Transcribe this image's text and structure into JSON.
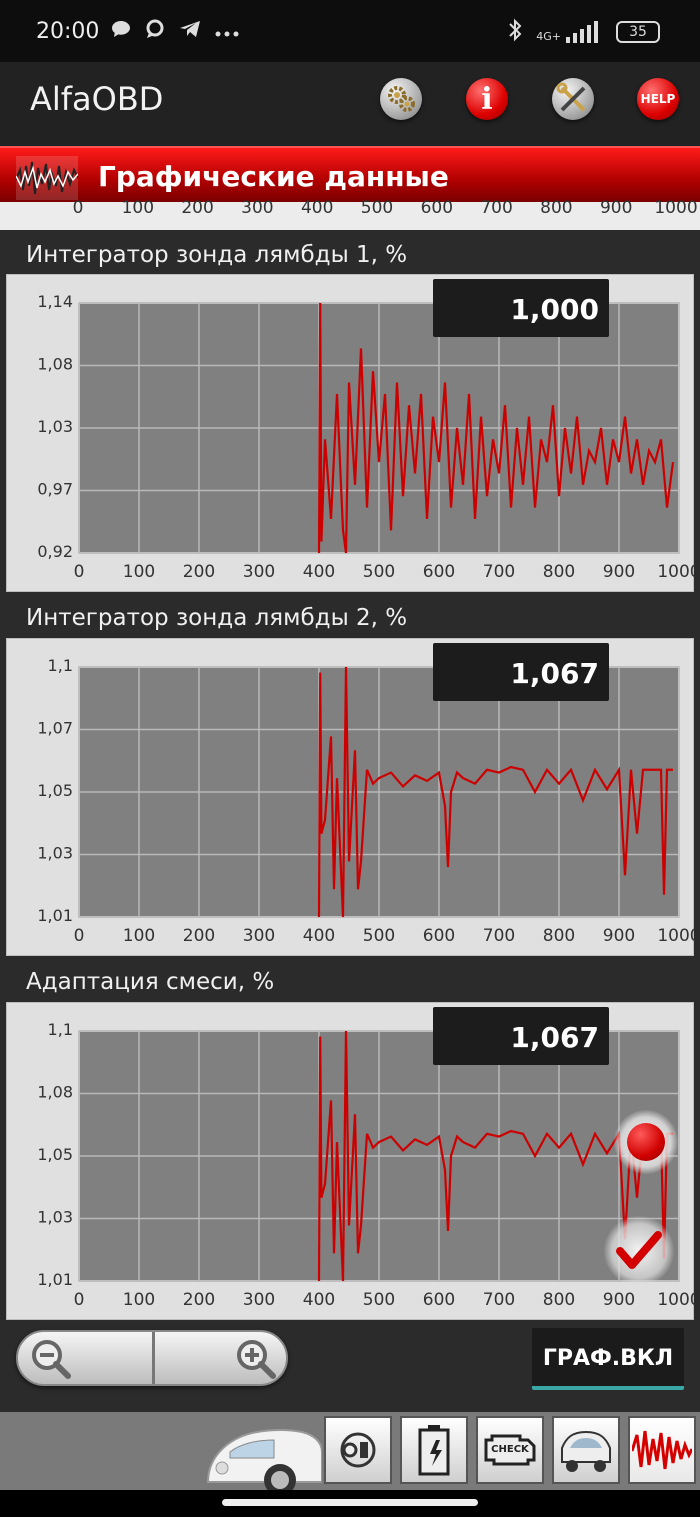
{
  "status_bar": {
    "time": "20:00",
    "network": "4G+",
    "battery": "35",
    "icons": [
      "chat-icon",
      "message-icon",
      "telegram-icon",
      "more-icon",
      "bluetooth-icon",
      "signal-icon",
      "battery-icon"
    ]
  },
  "app_bar": {
    "title": "AlfaOBD",
    "buttons": [
      {
        "name": "settings-gears-button",
        "icon": "gears-icon"
      },
      {
        "name": "info-button",
        "icon": "info-icon",
        "label": "i"
      },
      {
        "name": "tools-button",
        "icon": "tools-icon"
      },
      {
        "name": "help-button",
        "icon": "help-icon",
        "label": "HELP"
      }
    ]
  },
  "header": {
    "title": "Графические данные"
  },
  "shared_x_ticks": [
    "0",
    "100",
    "200",
    "300",
    "400",
    "500",
    "600",
    "700",
    "800",
    "900",
    "1000"
  ],
  "charts": [
    {
      "title": "Интегратор зонда лямбды 1, %",
      "current_value": "1,000",
      "y_ticks": [
        "1,14",
        "1,08",
        "1,03",
        "0,97",
        "0,92"
      ]
    },
    {
      "title": "Интегратор зонда лямбды 2, %",
      "current_value": "1,067",
      "y_ticks": [
        "1,1",
        "1,07",
        "1,05",
        "1,03",
        "1,01"
      ]
    },
    {
      "title": "Адаптация смеси, %",
      "current_value": "1,067",
      "y_ticks": [
        "1,1",
        "1,08",
        "1,05",
        "1,03",
        "1,01"
      ]
    }
  ],
  "chart_data": [
    {
      "type": "line",
      "title": "Интегратор зонда лямбды 1, %",
      "x_ticks": [
        0,
        100,
        200,
        300,
        400,
        500,
        600,
        700,
        800,
        900,
        1000
      ],
      "ylim": [
        0.92,
        1.14
      ],
      "y_ticks": [
        1.14,
        1.08,
        1.03,
        0.97,
        0.92
      ],
      "grid": true,
      "color": "#cc0000",
      "series": [
        {
          "x": [
            400,
            402,
            404,
            410,
            420,
            430,
            440,
            445,
            450,
            460,
            470,
            480,
            490,
            500,
            510,
            520,
            530,
            540,
            550,
            560,
            570,
            580,
            590,
            600,
            610,
            620,
            630,
            640,
            650,
            660,
            670,
            680,
            690,
            700,
            710,
            720,
            730,
            740,
            750,
            760,
            770,
            780,
            790,
            800,
            810,
            820,
            830,
            840,
            850,
            860,
            870,
            880,
            890,
            900,
            910,
            920,
            930,
            940,
            950,
            960,
            970,
            980,
            990
          ],
          "y": [
            0.92,
            1.14,
            0.93,
            1.02,
            0.95,
            1.06,
            0.94,
            0.92,
            1.07,
            0.98,
            1.1,
            0.96,
            1.08,
            1.0,
            1.06,
            0.94,
            1.07,
            0.97,
            1.05,
            0.99,
            1.06,
            0.95,
            1.04,
            1.0,
            1.07,
            0.96,
            1.03,
            0.98,
            1.06,
            0.95,
            1.04,
            0.97,
            1.02,
            0.99,
            1.05,
            0.96,
            1.03,
            0.98,
            1.04,
            0.96,
            1.02,
            1.0,
            1.05,
            0.97,
            1.03,
            0.99,
            1.04,
            0.98,
            1.01,
            1.0,
            1.03,
            0.98,
            1.02,
            1.0,
            1.04,
            0.99,
            1.02,
            0.98,
            1.01,
            1.0,
            1.02,
            0.96,
            1.0
          ]
        }
      ]
    },
    {
      "type": "line",
      "title": "Интегратор зонда лямбды 2, %",
      "x_ticks": [
        0,
        100,
        200,
        300,
        400,
        500,
        600,
        700,
        800,
        900,
        1000
      ],
      "ylim": [
        1.01,
        1.1
      ],
      "y_ticks": [
        1.1,
        1.07,
        1.05,
        1.03,
        1.01
      ],
      "grid": true,
      "color": "#cc0000",
      "series": [
        {
          "x": [
            400,
            402,
            404,
            410,
            420,
            425,
            430,
            440,
            445,
            450,
            460,
            465,
            470,
            480,
            490,
            500,
            520,
            540,
            560,
            580,
            600,
            610,
            615,
            620,
            630,
            640,
            660,
            680,
            700,
            720,
            740,
            760,
            780,
            800,
            820,
            840,
            860,
            880,
            900,
            910,
            920,
            930,
            940,
            960,
            970,
            975,
            980,
            990
          ],
          "y": [
            1.01,
            1.098,
            1.04,
            1.045,
            1.075,
            1.02,
            1.06,
            1.01,
            1.1,
            1.03,
            1.07,
            1.02,
            1.03,
            1.063,
            1.058,
            1.06,
            1.062,
            1.057,
            1.061,
            1.059,
            1.062,
            1.05,
            1.028,
            1.055,
            1.062,
            1.06,
            1.058,
            1.063,
            1.062,
            1.064,
            1.063,
            1.055,
            1.063,
            1.058,
            1.063,
            1.052,
            1.063,
            1.056,
            1.063,
            1.025,
            1.063,
            1.04,
            1.063,
            1.063,
            1.063,
            1.018,
            1.063,
            1.063
          ]
        }
      ]
    },
    {
      "type": "line",
      "title": "Адаптация смеси, %",
      "x_ticks": [
        0,
        100,
        200,
        300,
        400,
        500,
        600,
        700,
        800,
        900,
        1000
      ],
      "ylim": [
        1.01,
        1.1
      ],
      "y_ticks": [
        1.1,
        1.08,
        1.05,
        1.03,
        1.01
      ],
      "grid": true,
      "color": "#cc0000",
      "series": [
        {
          "x": [
            400,
            402,
            404,
            410,
            420,
            425,
            430,
            440,
            445,
            450,
            460,
            465,
            470,
            480,
            490,
            500,
            520,
            540,
            560,
            580,
            600,
            610,
            615,
            620,
            630,
            640,
            660,
            680,
            700,
            720,
            740,
            760,
            780,
            800,
            820,
            840,
            860,
            880,
            900,
            910,
            920,
            930,
            940,
            960,
            970,
            975,
            980,
            990
          ],
          "y": [
            1.01,
            1.098,
            1.04,
            1.045,
            1.075,
            1.02,
            1.06,
            1.01,
            1.1,
            1.03,
            1.07,
            1.02,
            1.03,
            1.063,
            1.058,
            1.06,
            1.062,
            1.057,
            1.061,
            1.059,
            1.062,
            1.05,
            1.028,
            1.055,
            1.062,
            1.06,
            1.058,
            1.063,
            1.062,
            1.064,
            1.063,
            1.055,
            1.063,
            1.058,
            1.063,
            1.052,
            1.063,
            1.056,
            1.063,
            1.025,
            1.063,
            1.04,
            1.063,
            1.063,
            1.063,
            1.018,
            1.063,
            1.063
          ]
        }
      ]
    }
  ],
  "controls": {
    "zoom_out_icon": "zoom-out-icon",
    "zoom_in_icon": "zoom-in-icon",
    "graph_button": "ГРАФ.ВКЛ"
  },
  "nav_strip": {
    "items": [
      {
        "name": "car-photo",
        "icon": "car-icon"
      },
      {
        "name": "key-button",
        "icon": "key-icon"
      },
      {
        "name": "battery-button",
        "icon": "battery-icon"
      },
      {
        "name": "check-engine-button",
        "icon": "check-engine-icon",
        "label": "CHECK"
      },
      {
        "name": "car-service-button",
        "icon": "car-hood-icon"
      },
      {
        "name": "graph-button",
        "icon": "waveform-icon"
      }
    ]
  },
  "colors": {
    "accent_red": "#cc0000",
    "header_red": "#d40000",
    "chart_bg": "#808080",
    "panel_bg": "#e0e0e0"
  }
}
